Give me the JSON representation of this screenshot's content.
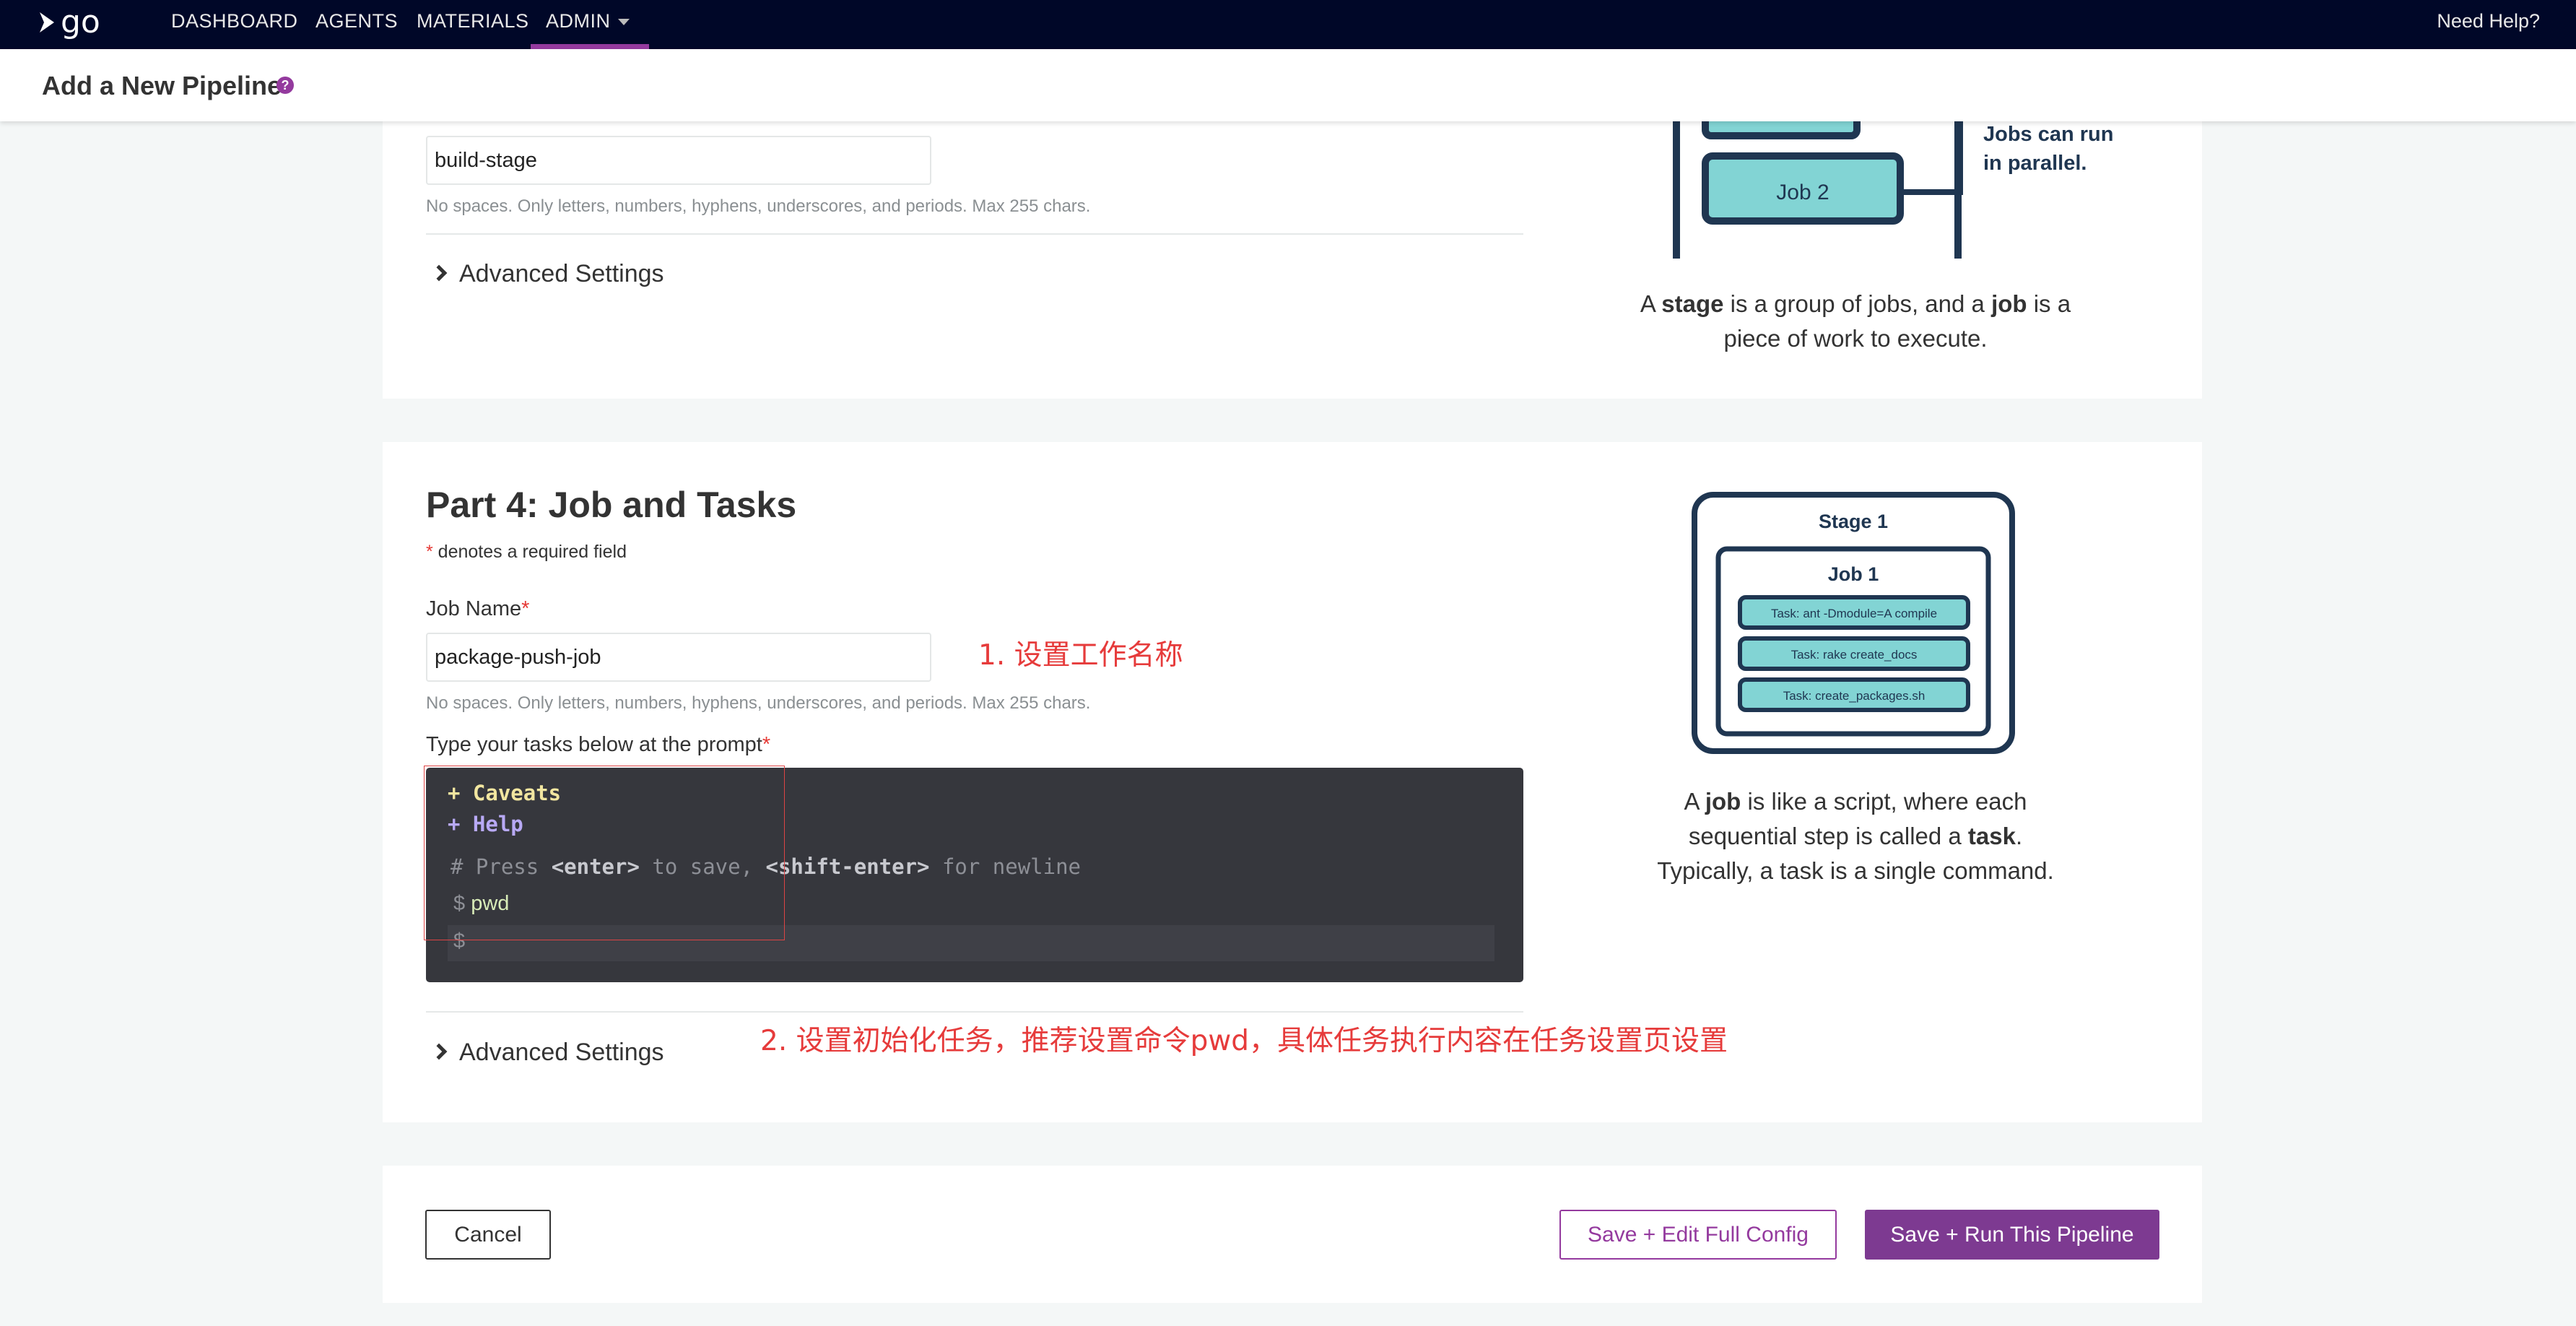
{
  "topnav": {
    "logo": "go",
    "items": [
      "DASHBOARD",
      "AGENTS",
      "MATERIALS",
      "ADMIN"
    ],
    "help": "Need Help?"
  },
  "header": {
    "title": "Add a New Pipeline",
    "help_icon": "?"
  },
  "stage_section": {
    "stage_name_value": "build-stage",
    "hint": "No spaces. Only letters, numbers, hyphens, underscores, and periods. Max 255 chars.",
    "advanced": "Advanced Settings",
    "illus_job2": "Job 2",
    "illus_note_1": "Jobs can run",
    "illus_note_2": "in parallel.",
    "caption": {
      "a": "A ",
      "stage": "stage",
      "mid": " is a group of jobs, and a ",
      "job": "job",
      "end": " is a",
      "line2": "piece of work to execute."
    }
  },
  "job_section": {
    "title": "Part 4: Job and Tasks",
    "required_star": "*",
    "required_note": " denotes a required field",
    "job_name_label": "Job Name",
    "job_name_value": "package-push-job",
    "hint": "No spaces. Only letters, numbers, hyphens, underscores, and periods. Max 255 chars.",
    "tasks_label": "Type your tasks below at the prompt",
    "terminal": {
      "caveats": "+ Caveats",
      "help": "+ Help",
      "hint_hash": "# Press ",
      "hint_enter": "<enter>",
      "hint_mid": " to save, ",
      "hint_shift": "<shift-enter>",
      "hint_end": " for newline",
      "prompt": "$",
      "cmd": "pwd"
    },
    "advanced": "Advanced Settings",
    "illus": {
      "stage": "Stage 1",
      "job": "Job 1",
      "task1": "Task: ant -Dmodule=A compile",
      "task2": "Task: rake create_docs",
      "task3": "Task: create_packages.sh"
    },
    "caption": {
      "a": "A ",
      "job": "job",
      "l1": " is like a script, where each",
      "l2a": "sequential step is called a ",
      "task": "task",
      "l2b": ".",
      "l3": "Typically, a task is a single command."
    }
  },
  "annotations": {
    "a1": "1. 设置工作名称",
    "a2": "2. 设置初始化任务，推荐设置命令pwd，具体任务执行内容在任务设置页设置"
  },
  "buttons": {
    "cancel": "Cancel",
    "edit": "Save + Edit Full Config",
    "run": "Save + Run This Pipeline"
  },
  "colors": {
    "nav_bg": "#000728",
    "accent": "#943a9e",
    "teal": "#82d4d4",
    "navy": "#1f3651",
    "annotation": "#e63b3b"
  }
}
